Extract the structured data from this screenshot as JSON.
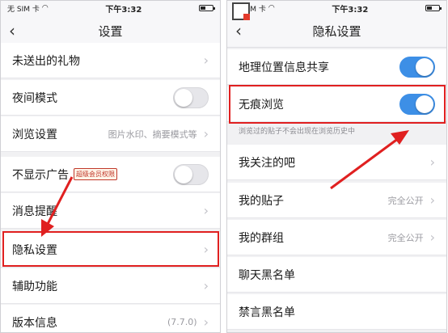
{
  "colors": {
    "accent": "#3d8fe6",
    "highlight": "#e02020"
  },
  "left": {
    "status": {
      "carrier": "无 SIM 卡",
      "time": "下午3:32"
    },
    "nav": {
      "back_icon": "chevron-left-icon",
      "title": "设置"
    },
    "rows": {
      "gifts": "未送出的礼物",
      "night": "夜间模式",
      "browse": "浏览设置",
      "browse_value": "图片水印、摘要模式等",
      "noads": "不显示广告",
      "noads_badge": "超级会员权限",
      "notify": "消息提醒",
      "privacy": "隐私设置",
      "assist": "辅助功能",
      "version": "版本信息",
      "version_value": "(7.7.0)"
    }
  },
  "right": {
    "status": {
      "carrier": "无 SIM 卡",
      "time": "下午3:32"
    },
    "nav": {
      "back_icon": "chevron-left-icon",
      "title": "隐私设置"
    },
    "rows": {
      "location": "地理位置信息共享",
      "trace": "无痕浏览",
      "trace_hint": "浏览过的贴子不会出现在浏览历史中",
      "follow": "我关注的吧",
      "posts": "我的贴子",
      "posts_value": "完全公开",
      "groups": "我的群组",
      "groups_value": "完全公开",
      "chat_black": "聊天黑名单",
      "mute_black": "禁言黑名单"
    }
  }
}
